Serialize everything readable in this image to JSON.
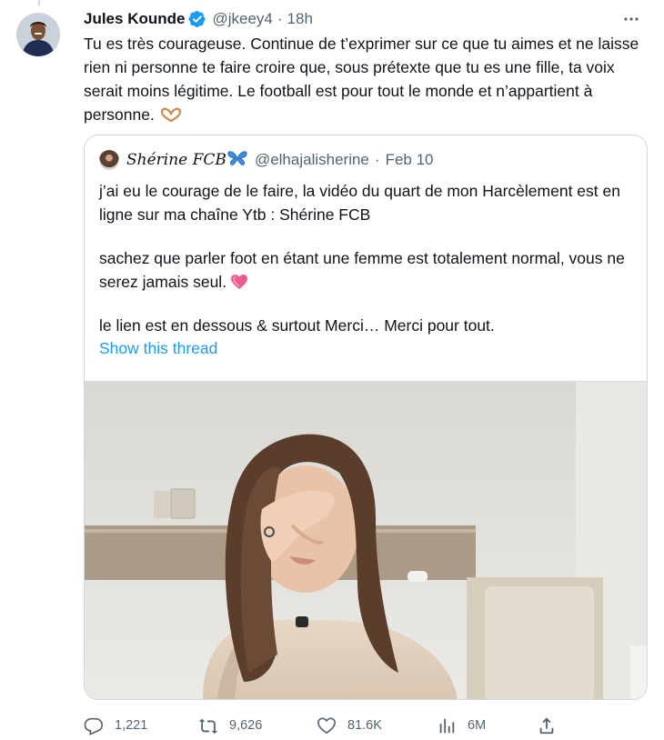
{
  "tweet": {
    "author_name": "Jules Kounde",
    "handle": "@jkeey4",
    "separator": "·",
    "time": "18h",
    "text": "Tu es très courageuse. Continue de t’exprimer sur ce que tu aimes et ne laisse rien ni personne te faire croire que, sous prétexte que tu es une fille, ta voix serait moins légitime. Le football est  pour tout le monde et n’appartient à personne."
  },
  "quote": {
    "author_name": "Shérine FCB",
    "handle": "@elhajalisherine",
    "separator": "·",
    "time": "Feb 10",
    "paragraphs": [
      "j’ai eu le courage de le faire, la vidéo du quart de mon Harcèlement est en ligne sur ma chaîne Ytb : Shérine FCB",
      "sachez que parler foot en étant une femme est totalement normal, vous ne serez jamais seul.",
      "le lien est en dessous & surtout Merci… Merci pour tout."
    ],
    "show_thread": "Show this thread"
  },
  "actions": {
    "replies": "1,221",
    "retweets": "9,626",
    "likes": "81.6K",
    "views": "6M"
  },
  "icons": {
    "verified": "verified-badge-icon",
    "more": "more-options-icon",
    "reply": "reply-icon",
    "retweet": "retweet-icon",
    "like": "heart-icon",
    "views": "views-icon",
    "share": "share-icon",
    "butterfly": "butterfly-emoji",
    "heart_hands": "heart-hands-emoji",
    "pink_heart": "pink-heart-emoji"
  },
  "colors": {
    "link": "#1d9bf0",
    "muted": "#536471",
    "border": "#cfd9de",
    "text": "#0f1419"
  }
}
